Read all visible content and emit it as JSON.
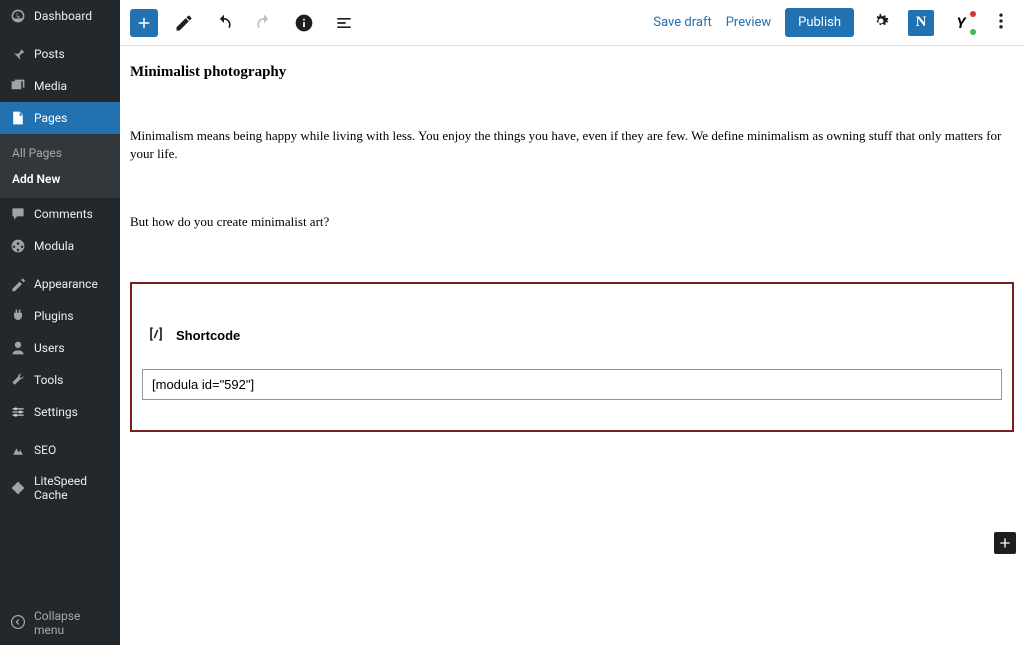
{
  "sidebar": {
    "items": [
      {
        "label": "Dashboard"
      },
      {
        "label": "Posts"
      },
      {
        "label": "Media"
      },
      {
        "label": "Pages"
      },
      {
        "label": "Comments"
      },
      {
        "label": "Modula"
      },
      {
        "label": "Appearance"
      },
      {
        "label": "Plugins"
      },
      {
        "label": "Users"
      },
      {
        "label": "Tools"
      },
      {
        "label": "Settings"
      },
      {
        "label": "SEO"
      },
      {
        "label": "LiteSpeed Cache"
      }
    ],
    "pages_sub": {
      "all_pages": "All Pages",
      "add_new": "Add New"
    },
    "collapse": "Collapse menu"
  },
  "topbar": {
    "save_draft": "Save draft",
    "preview": "Preview",
    "publish": "Publish",
    "n_label": "N",
    "yoast_label": "Y"
  },
  "post": {
    "title": "Minimalist photography",
    "para1": "Minimalism means being happy while living with less. You enjoy the things you have, even if they are few. We define minimalism as owning stuff that only matters for your life.",
    "para2": "But how do you create minimalist art?"
  },
  "shortcode_block": {
    "title": "Shortcode",
    "value": "[modula id=\"592\"]"
  }
}
